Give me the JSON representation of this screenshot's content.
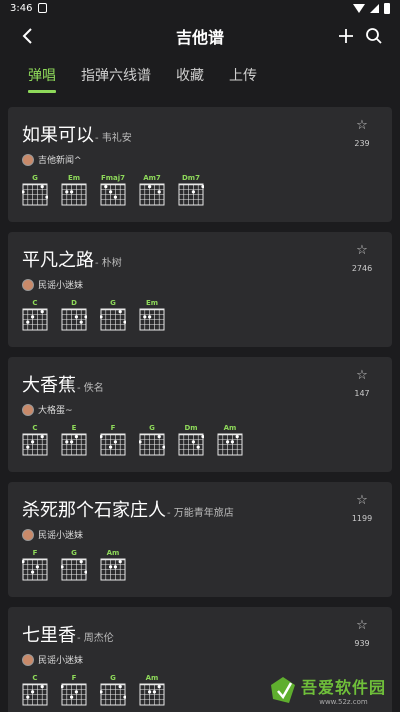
{
  "status": {
    "time": "3:46"
  },
  "app_bar": {
    "title": "吉他谱"
  },
  "tabs": [
    {
      "label": "弹唱",
      "active": true
    },
    {
      "label": "指弹六线谱",
      "active": false
    },
    {
      "label": "收藏",
      "active": false
    },
    {
      "label": "上传",
      "active": false
    }
  ],
  "songs": [
    {
      "title": "如果可以",
      "artist": "- 韦礼安",
      "uploader": "吉他新闻^",
      "favorites": "239",
      "chords": [
        "G",
        "Em",
        "Fmaj7",
        "Am7",
        "Dm7"
      ]
    },
    {
      "title": "平凡之路",
      "artist": "- 朴树",
      "uploader": "民谣小迷妹",
      "favorites": "2746",
      "chords": [
        "C",
        "D",
        "G",
        "Em"
      ]
    },
    {
      "title": "大香蕉",
      "artist": "- 佚名",
      "uploader": "大格蛋~",
      "favorites": "147",
      "chords": [
        "C",
        "E",
        "F",
        "G",
        "Dm",
        "Am"
      ]
    },
    {
      "title": "杀死那个石家庄人",
      "artist": "- 万能青年旅店",
      "uploader": "民谣小迷妹",
      "favorites": "1199",
      "chords": [
        "F",
        "G",
        "Am"
      ]
    },
    {
      "title": "七里香",
      "artist": "- 周杰伦",
      "uploader": "民谣小迷妹",
      "favorites": "939",
      "chords": [
        "C",
        "F",
        "G",
        "Am"
      ]
    }
  ],
  "watermark": {
    "title": "吾爱软件园",
    "url": "www.52z.com"
  },
  "colors": {
    "accent": "#8ed95a",
    "background": "#1c1c1e",
    "card": "#2c2c2e"
  }
}
